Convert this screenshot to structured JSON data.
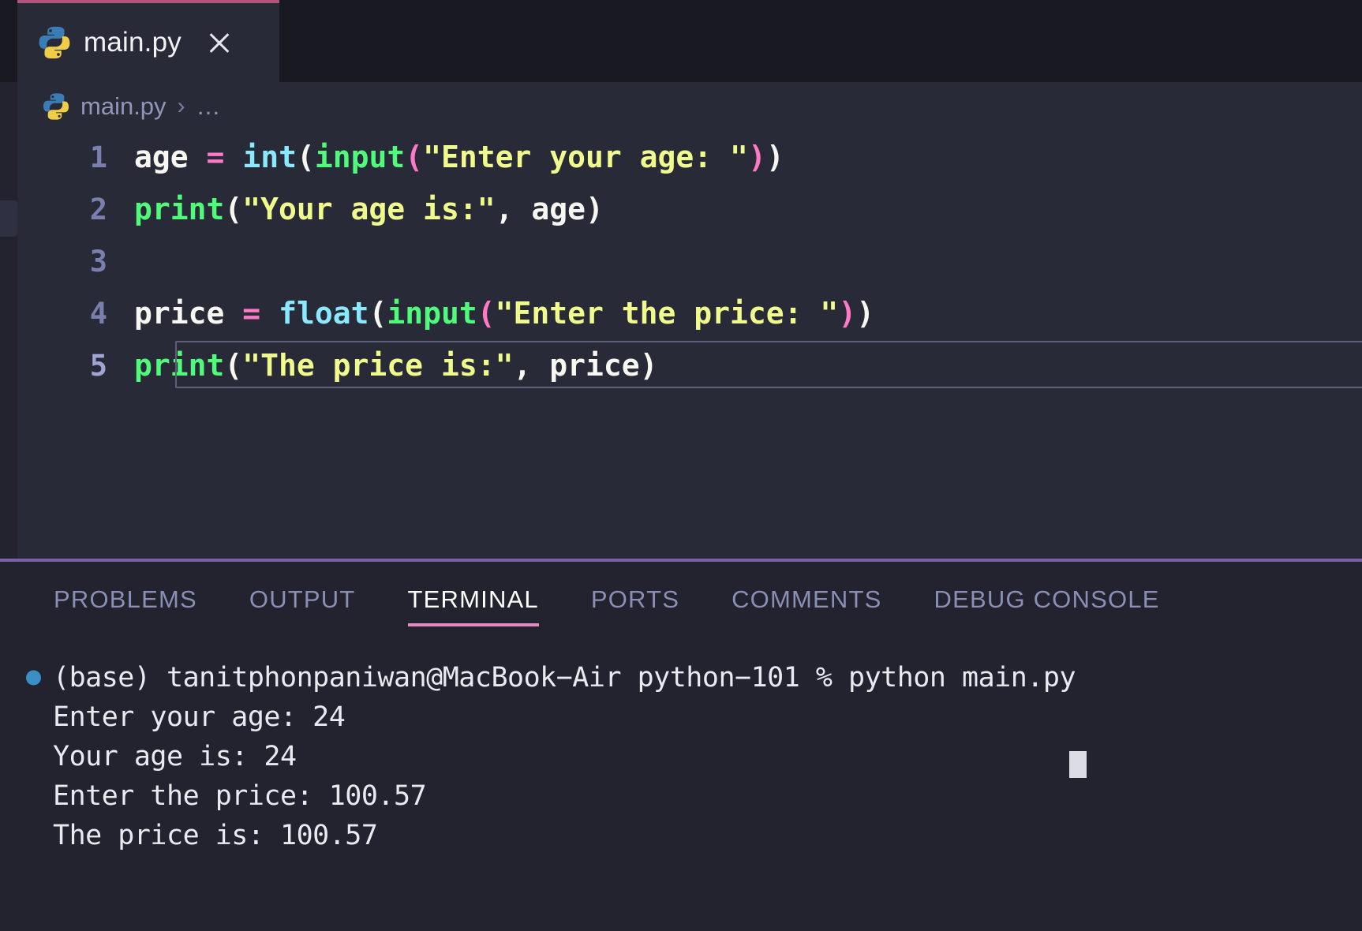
{
  "window": {
    "theme_bg": "#282a37",
    "accent_pink": "#e48bc0",
    "accent_purple": "#7b61a8"
  },
  "tab": {
    "label": "main.py",
    "icon": "python-icon",
    "close_icon": "close-icon"
  },
  "breadcrumb": {
    "icon": "python-icon",
    "file": "main.py",
    "separator": "›",
    "overflow": "…"
  },
  "editor": {
    "lines": [
      {
        "number": "1",
        "tokens": [
          {
            "text": "age",
            "cls": "t-var"
          },
          {
            "text": " ",
            "cls": "t-var"
          },
          {
            "text": "=",
            "cls": "t-op"
          },
          {
            "text": " ",
            "cls": "t-var"
          },
          {
            "text": "int",
            "cls": "t-fn"
          },
          {
            "text": "(",
            "cls": "t-paren"
          },
          {
            "text": "input",
            "cls": "t-builtin"
          },
          {
            "text": "(",
            "cls": "t-paren2"
          },
          {
            "text": "\"Enter your age: \"",
            "cls": "t-str"
          },
          {
            "text": ")",
            "cls": "t-paren2"
          },
          {
            "text": ")",
            "cls": "t-paren"
          }
        ],
        "plain": "age = int(input(\"Enter your age: \"))"
      },
      {
        "number": "2",
        "tokens": [
          {
            "text": "print",
            "cls": "t-builtin"
          },
          {
            "text": "(",
            "cls": "t-paren"
          },
          {
            "text": "\"Your age is:\"",
            "cls": "t-str"
          },
          {
            "text": ", ",
            "cls": "t-paren"
          },
          {
            "text": "age",
            "cls": "t-var"
          },
          {
            "text": ")",
            "cls": "t-paren"
          }
        ],
        "plain": "print(\"Your age is:\", age)"
      },
      {
        "number": "3",
        "tokens": [],
        "plain": ""
      },
      {
        "number": "4",
        "tokens": [
          {
            "text": "price",
            "cls": "t-var"
          },
          {
            "text": " ",
            "cls": "t-var"
          },
          {
            "text": "=",
            "cls": "t-op"
          },
          {
            "text": " ",
            "cls": "t-var"
          },
          {
            "text": "float",
            "cls": "t-fn"
          },
          {
            "text": "(",
            "cls": "t-paren"
          },
          {
            "text": "input",
            "cls": "t-builtin"
          },
          {
            "text": "(",
            "cls": "t-paren2"
          },
          {
            "text": "\"Enter the price: \"",
            "cls": "t-str"
          },
          {
            "text": ")",
            "cls": "t-paren2"
          },
          {
            "text": ")",
            "cls": "t-paren"
          }
        ],
        "plain": "price = float(input(\"Enter the price: \"))"
      },
      {
        "number": "5",
        "selected": true,
        "tokens": [
          {
            "text": "print",
            "cls": "t-builtin"
          },
          {
            "text": "(",
            "cls": "t-paren"
          },
          {
            "text": "\"The price is:\"",
            "cls": "t-str"
          },
          {
            "text": ", ",
            "cls": "t-paren"
          },
          {
            "text": "price",
            "cls": "t-var"
          },
          {
            "text": ")",
            "cls": "t-paren"
          }
        ],
        "plain": "print(\"The price is:\", price)"
      }
    ]
  },
  "panel": {
    "tabs": [
      {
        "label": "PROBLEMS",
        "active": false
      },
      {
        "label": "OUTPUT",
        "active": false
      },
      {
        "label": "TERMINAL",
        "active": true
      },
      {
        "label": "PORTS",
        "active": false
      },
      {
        "label": "COMMENTS",
        "active": false
      },
      {
        "label": "DEBUG CONSOLE",
        "active": false
      }
    ]
  },
  "terminal": {
    "lines": [
      {
        "text": "(base) tanitphonpaniwan@MacBook−Air python−101 % python main.py",
        "bullet": true
      },
      {
        "text": "Enter your age: 24",
        "bullet": false
      },
      {
        "text": "Your age is: 24",
        "bullet": false
      },
      {
        "text": "Enter the price: 100.57",
        "bullet": false
      },
      {
        "text": "The price is: 100.57",
        "bullet": false
      }
    ]
  }
}
